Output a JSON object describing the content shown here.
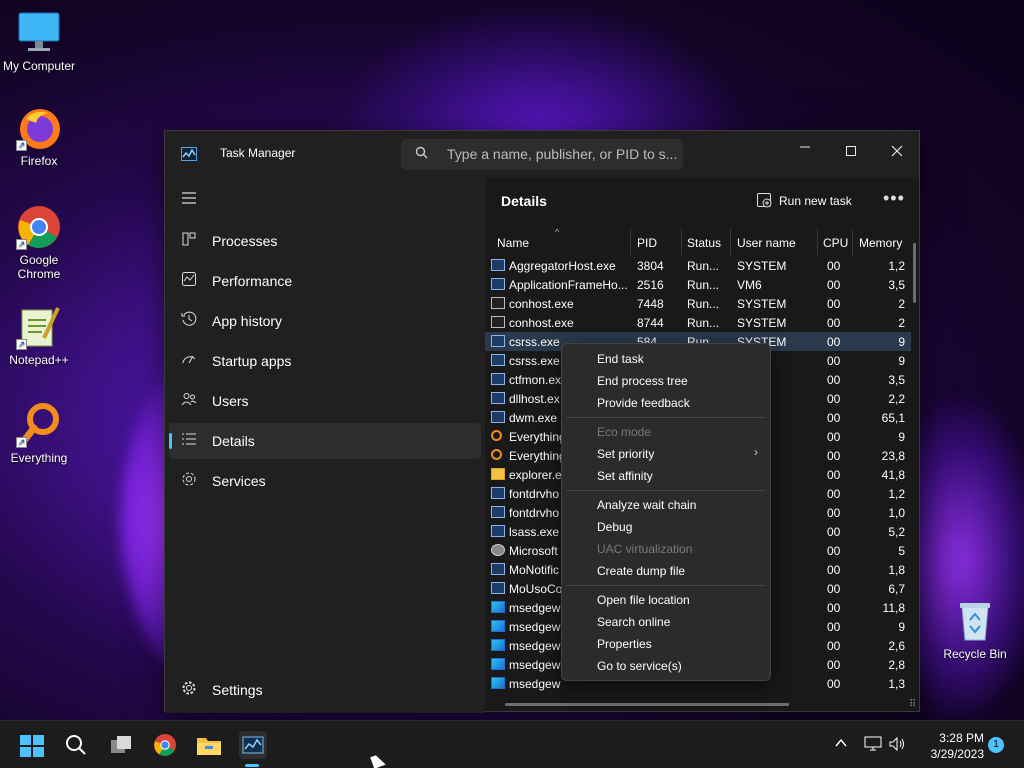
{
  "desktop": {
    "icons": [
      {
        "name": "my-computer",
        "label": "My Computer"
      },
      {
        "name": "firefox",
        "label": "Firefox"
      },
      {
        "name": "google-chrome",
        "label": "Google Chrome"
      },
      {
        "name": "notepad-plus-plus",
        "label": "Notepad++"
      },
      {
        "name": "everything",
        "label": "Everything"
      },
      {
        "name": "recycle-bin",
        "label": "Recycle Bin"
      }
    ]
  },
  "window": {
    "title": "Task Manager",
    "search_placeholder": "Type a name, publisher, or PID to s...",
    "controls": {
      "minimize": "—",
      "maximize": "☐",
      "close": "✕"
    }
  },
  "sidebar": {
    "items": [
      {
        "label": "Processes",
        "icon": "processes-icon"
      },
      {
        "label": "Performance",
        "icon": "performance-icon"
      },
      {
        "label": "App history",
        "icon": "app-history-icon"
      },
      {
        "label": "Startup apps",
        "icon": "startup-apps-icon"
      },
      {
        "label": "Users",
        "icon": "users-icon"
      },
      {
        "label": "Details",
        "icon": "details-icon",
        "active": true
      },
      {
        "label": "Services",
        "icon": "services-icon"
      }
    ],
    "settings_label": "Settings"
  },
  "details": {
    "title": "Details",
    "run_new_task": "Run new task",
    "more": "•••",
    "columns": [
      "Name",
      "PID",
      "Status",
      "User name",
      "CPU",
      "Memory"
    ],
    "rows": [
      {
        "name": "AggregatorHost.exe",
        "pid": "3804",
        "status": "Run...",
        "user": "SYSTEM",
        "cpu": "00",
        "mem": "1,2",
        "icon": "window"
      },
      {
        "name": "ApplicationFrameHo...",
        "pid": "2516",
        "status": "Run...",
        "user": "VM6",
        "cpu": "00",
        "mem": "3,5",
        "icon": "window"
      },
      {
        "name": "conhost.exe",
        "pid": "7448",
        "status": "Run...",
        "user": "SYSTEM",
        "cpu": "00",
        "mem": "2",
        "icon": "console"
      },
      {
        "name": "conhost.exe",
        "pid": "8744",
        "status": "Run...",
        "user": "SYSTEM",
        "cpu": "00",
        "mem": "2",
        "icon": "console"
      },
      {
        "name": "csrss.exe",
        "pid": "584",
        "status": "Run...",
        "user": "SYSTEM",
        "cpu": "00",
        "mem": "9",
        "icon": "window",
        "selected": true
      },
      {
        "name": "csrss.exe",
        "pid": "",
        "status": "",
        "user": "M",
        "cpu": "00",
        "mem": "9",
        "icon": "window"
      },
      {
        "name": "ctfmon.ex",
        "pid": "",
        "status": "",
        "user": "",
        "cpu": "00",
        "mem": "3,5",
        "icon": "window"
      },
      {
        "name": "dllhost.ex",
        "pid": "",
        "status": "",
        "user": "",
        "cpu": "00",
        "mem": "2,2",
        "icon": "window"
      },
      {
        "name": "dwm.exe",
        "pid": "",
        "status": "",
        "user": "1",
        "cpu": "00",
        "mem": "65,1",
        "icon": "window"
      },
      {
        "name": "Everything",
        "pid": "",
        "status": "",
        "user": "M",
        "cpu": "00",
        "mem": "9",
        "icon": "search"
      },
      {
        "name": "Everything",
        "pid": "",
        "status": "",
        "user": "",
        "cpu": "00",
        "mem": "23,8",
        "icon": "search"
      },
      {
        "name": "explorer.e",
        "pid": "",
        "status": "",
        "user": "",
        "cpu": "00",
        "mem": "41,8",
        "icon": "folder"
      },
      {
        "name": "fontdrvho",
        "pid": "",
        "status": "",
        "user": "-1",
        "cpu": "00",
        "mem": "1,2",
        "icon": "window"
      },
      {
        "name": "fontdrvho",
        "pid": "",
        "status": "",
        "user": "-0",
        "cpu": "00",
        "mem": "1,0",
        "icon": "window"
      },
      {
        "name": "lsass.exe",
        "pid": "",
        "status": "",
        "user": "M",
        "cpu": "00",
        "mem": "5,2",
        "icon": "window"
      },
      {
        "name": "Microsoft",
        "pid": "",
        "status": "",
        "user": "M",
        "cpu": "00",
        "mem": "5",
        "icon": "gear"
      },
      {
        "name": "MoNotific",
        "pid": "",
        "status": "",
        "user": "",
        "cpu": "00",
        "mem": "1,8",
        "icon": "window"
      },
      {
        "name": "MoUsoCo",
        "pid": "",
        "status": "",
        "user": "M",
        "cpu": "00",
        "mem": "6,7",
        "icon": "window"
      },
      {
        "name": "msedgew",
        "pid": "",
        "status": "",
        "user": "",
        "cpu": "00",
        "mem": "11,8",
        "icon": "edge"
      },
      {
        "name": "msedgew",
        "pid": "",
        "status": "",
        "user": "",
        "cpu": "00",
        "mem": "9",
        "icon": "edge"
      },
      {
        "name": "msedgew",
        "pid": "",
        "status": "",
        "user": "",
        "cpu": "00",
        "mem": "2,6",
        "icon": "edge"
      },
      {
        "name": "msedgew",
        "pid": "",
        "status": "",
        "user": "",
        "cpu": "00",
        "mem": "2,8",
        "icon": "edge"
      },
      {
        "name": "msedgew",
        "pid": "",
        "status": "",
        "user": "",
        "cpu": "00",
        "mem": "1,3",
        "icon": "edge"
      }
    ]
  },
  "context_menu": {
    "items": [
      {
        "label": "End task",
        "disabled": false
      },
      {
        "label": "End process tree",
        "disabled": false
      },
      {
        "label": "Provide feedback",
        "disabled": false
      },
      {
        "label": "Eco mode",
        "disabled": true
      },
      {
        "label": "Set priority",
        "disabled": false,
        "submenu": true
      },
      {
        "label": "Set affinity",
        "disabled": false
      },
      {
        "label": "Analyze wait chain",
        "disabled": false
      },
      {
        "label": "Debug",
        "disabled": false
      },
      {
        "label": "UAC virtualization",
        "disabled": true
      },
      {
        "label": "Create dump file",
        "disabled": false
      },
      {
        "label": "Open file location",
        "disabled": false
      },
      {
        "label": "Search online",
        "disabled": false
      },
      {
        "label": "Properties",
        "disabled": false
      },
      {
        "label": "Go to service(s)",
        "disabled": false
      }
    ],
    "submenu_arrow": "›"
  },
  "taskbar": {
    "time": "3:28 PM",
    "date": "3/29/2023",
    "notification_count": "1"
  },
  "colors": {
    "accent": "#4cc2ff",
    "window_bg": "#202020",
    "menu_bg": "#2b2b2b"
  }
}
